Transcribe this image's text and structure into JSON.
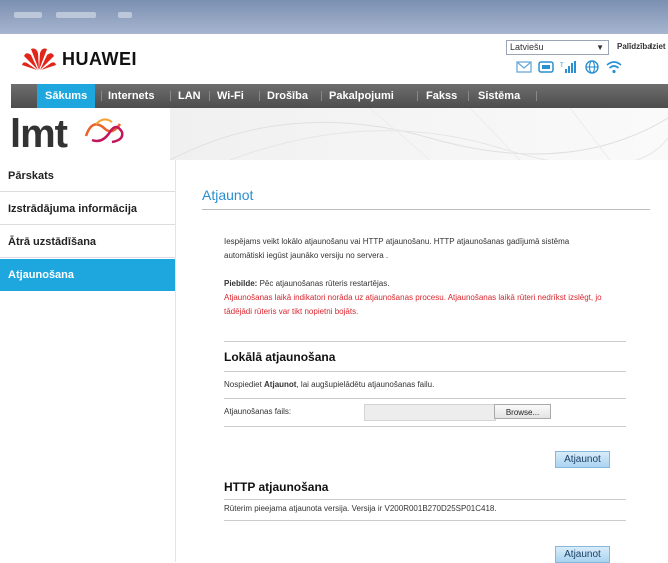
{
  "brand": {
    "name": "HUAWEI",
    "operator": "lmt"
  },
  "header": {
    "language": "Latviešu",
    "help": "Palīdzība",
    "logout": "Iziet",
    "status_icons": [
      "envelope-icon",
      "sim-icon",
      "signal-icon",
      "globe-icon",
      "wifi-icon"
    ]
  },
  "nav": {
    "items": [
      "Sākums",
      "Internets",
      "LAN",
      "Wi-Fi",
      "Drošība",
      "Pakalpojumi",
      "Fakss",
      "Sistēma"
    ],
    "active": "Sākums"
  },
  "sidebar": {
    "items": [
      "Pārskats",
      "Izstrādājuma informācija",
      "Ātrā uzstādīšana",
      "Atjaunošana"
    ],
    "active": "Atjaunošana"
  },
  "main": {
    "title": "Atjaunot",
    "desc_line1": "Iespējams veikt lokālo atjaunošanu vai HTTP atjaunošanu. HTTP atjaunošanas gadījumā sistēma",
    "desc_line2": "automātiski iegūst jaunāko versiju no servera .",
    "note_label": "Piebilde:",
    "note_text": " Pēc atjaunošanas rūteris restartējas.",
    "warning_line1": "Atjaunošanas laikā indikatori norāda uz atjaunošanas procesu. Atjaunošanas laikā rūteri nedrīkst izslēgt, jo",
    "warning_line2": "tādējādi rūteris var tikt nopietni bojāts."
  },
  "local": {
    "title": "Lokālā atjaunošana",
    "instr_pre": "Nospiediet ",
    "instr_bold": "Atjaunot",
    "instr_post": ", lai augšupielādētu atjaunošanas failu.",
    "file_label": "Atjaunošanas fails:",
    "browse": "Browse...",
    "button": "Atjaunot"
  },
  "http": {
    "title": "HTTP atjaunošana",
    "text": "Rūterim pieejama atjaunota versija. Versija ir V200R001B270D25SP01C418.",
    "button": "Atjaunot"
  },
  "colors": {
    "accent": "#1ea7de",
    "title": "#2a8fd0",
    "warning": "#d9262e",
    "brand": "#e1251b"
  }
}
